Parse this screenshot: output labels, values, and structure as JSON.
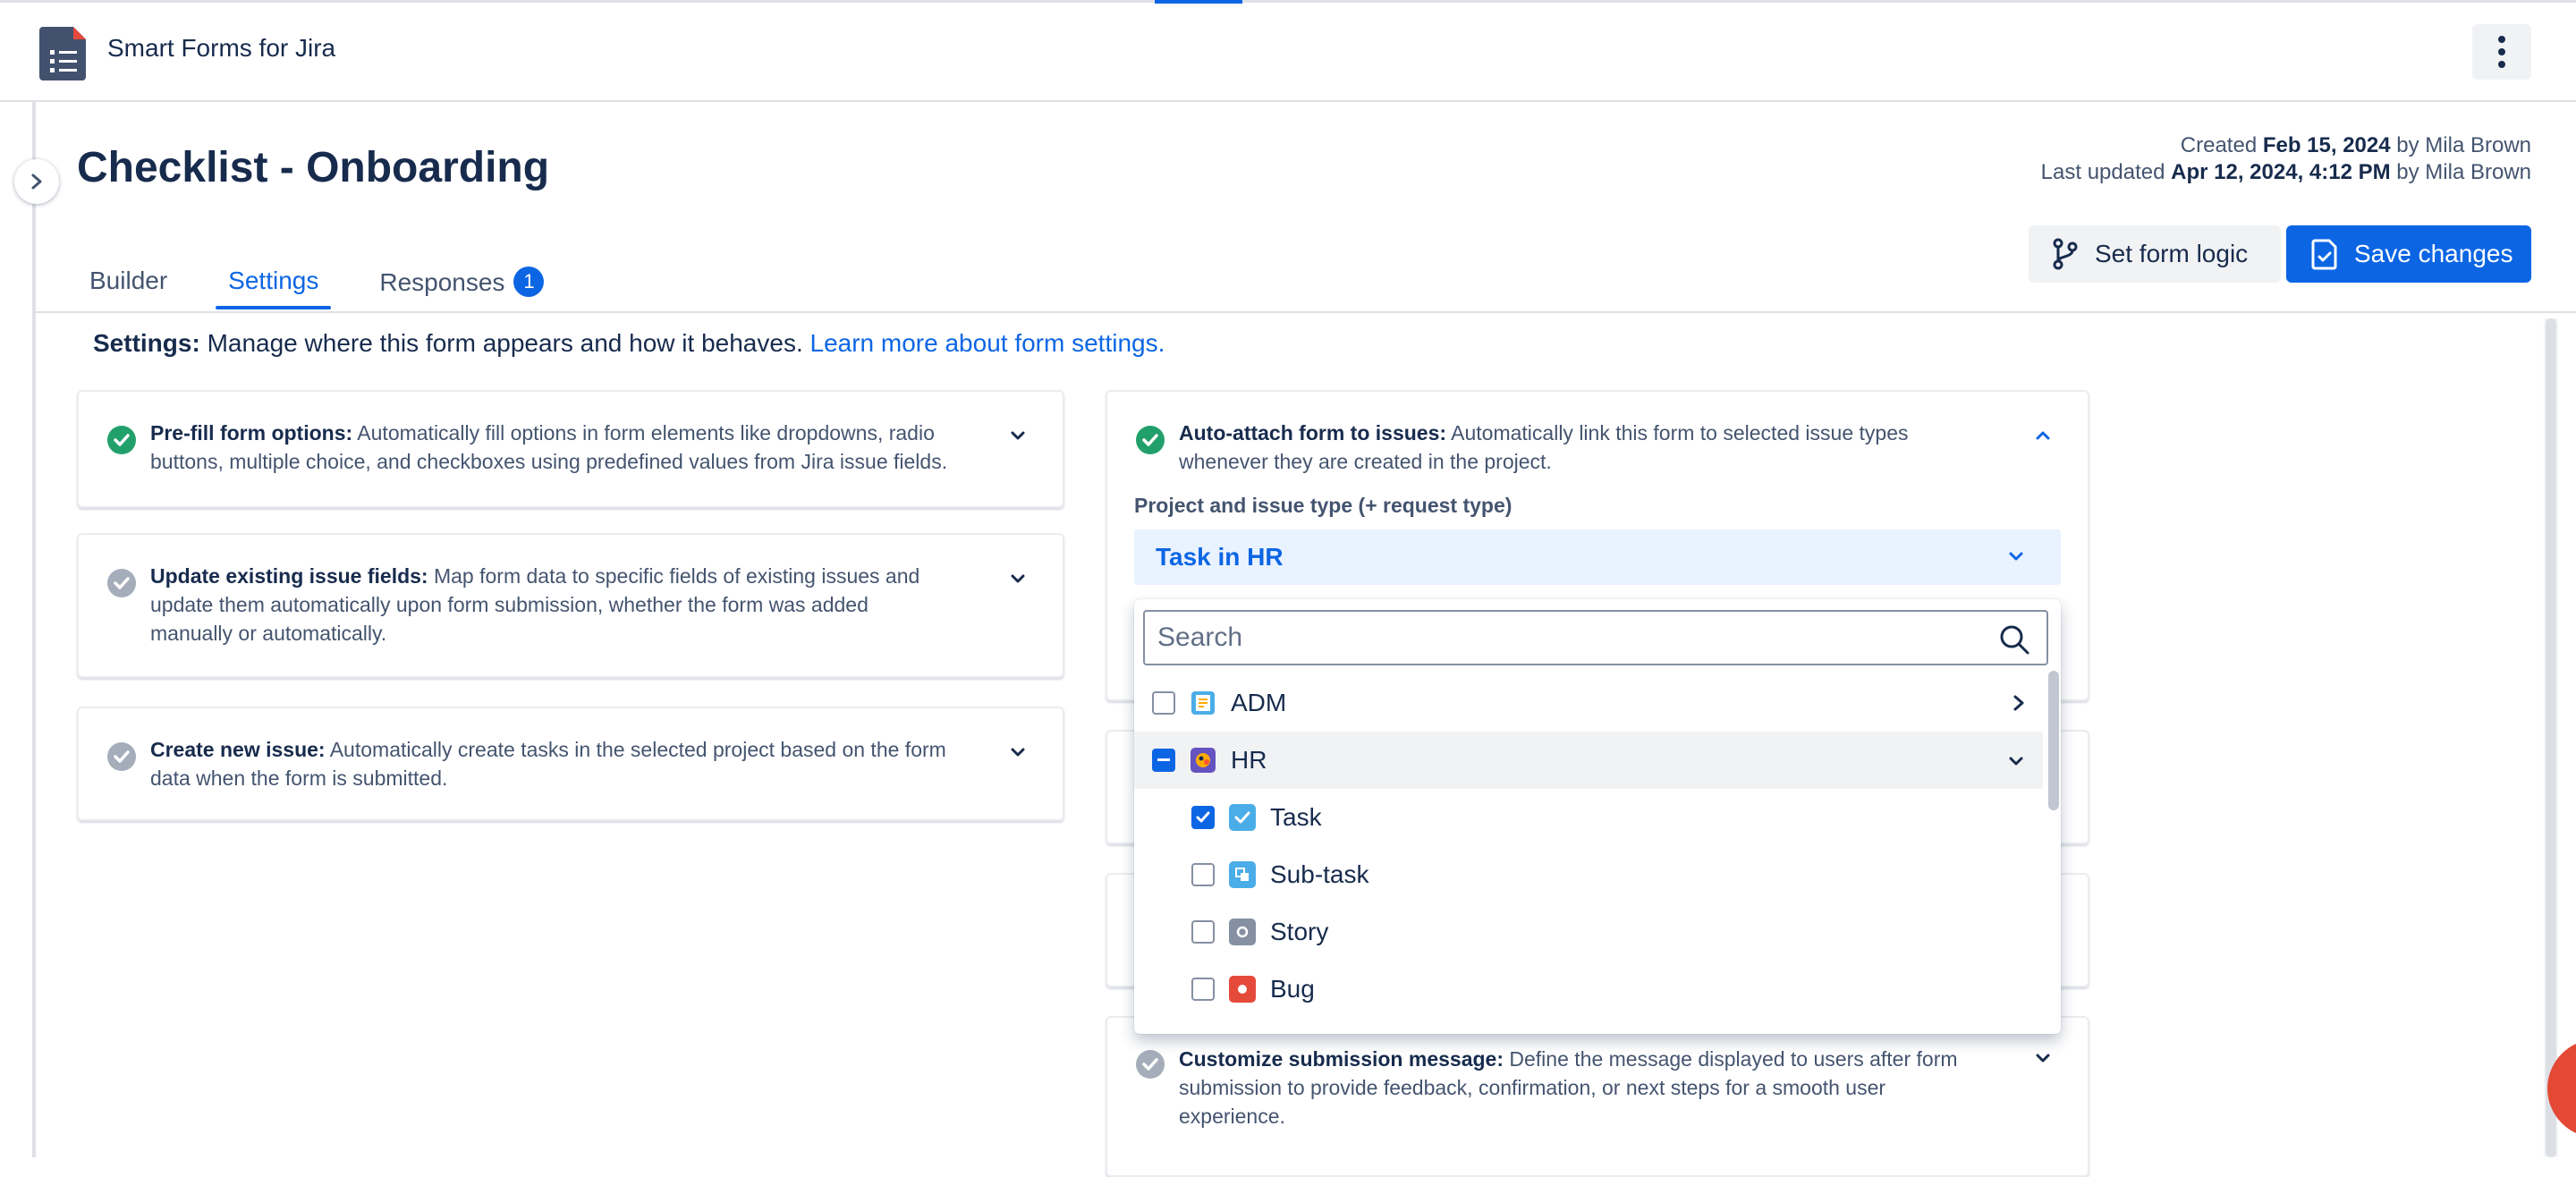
{
  "app": {
    "name": "Smart Forms for Jira"
  },
  "page": {
    "title": "Checklist - Onboarding",
    "created_label": "Created",
    "created_date": "Feb 15, 2024",
    "created_by": "by Mila Brown",
    "updated_label": "Last updated",
    "updated_date": "Apr 12, 2024, 4:12 PM",
    "updated_by": "by Mila Brown"
  },
  "tabs": [
    {
      "label": "Builder",
      "active": false
    },
    {
      "label": "Settings",
      "active": true
    },
    {
      "label": "Responses",
      "active": false,
      "badge": "1"
    }
  ],
  "actions": {
    "form_logic": "Set form logic",
    "save": "Save changes"
  },
  "intro": {
    "prefix": "Settings:",
    "text": "Manage where this form appears and how it behaves.",
    "link": "Learn more about form settings."
  },
  "cards_left": [
    {
      "title": "Pre-fill form options:",
      "line1": "Automatically fill options in form elements like dropdowns, radio",
      "line2": "buttons, multiple choice, and checkboxes using predefined values from Jira issue fields.",
      "status": "ok"
    },
    {
      "title": "Update existing issue fields:",
      "line1": "Map form data to specific fields of existing issues and",
      "line2": "update them automatically upon form submission, whether the form was added",
      "line3": "manually or automatically.",
      "status": "pending"
    },
    {
      "title": "Create new issue:",
      "line1": "Automatically create tasks in the selected project based on the form",
      "line2": "data when the form is submitted.",
      "status": "pending"
    }
  ],
  "auto_attach": {
    "title": "Auto-attach form to issues:",
    "line1": "Automatically link this form to selected issue types",
    "line2": "whenever they are created in the project.",
    "field_label": "Project and issue type (+ request type)",
    "selected": "Task in HR",
    "search_placeholder": "Search",
    "options": [
      {
        "label": "ADM",
        "state": "unchecked",
        "icon": "project-adm-icon"
      },
      {
        "label": "HR",
        "state": "indeterminate",
        "icon": "project-hr-icon"
      },
      {
        "label": "Task",
        "state": "checked",
        "icon": "task-icon",
        "color": "#4bade8"
      },
      {
        "label": "Sub-task",
        "state": "unchecked",
        "icon": "subtask-icon",
        "color": "#4bade8"
      },
      {
        "label": "Story",
        "state": "unchecked",
        "icon": "story-icon",
        "color": "#8590a2"
      },
      {
        "label": "Bug",
        "state": "unchecked",
        "icon": "bug-icon",
        "color": "#e5493a"
      }
    ]
  },
  "submission_card": {
    "title": "Customize submission message:",
    "line1": "Define the message displayed to users after form",
    "line2": "submission to provide feedback, confirmation, or next steps for a smooth user",
    "line3": "experience."
  },
  "colors": {
    "accent": "#0c66e4",
    "success": "#22a06b",
    "pending": "#a5adba"
  }
}
